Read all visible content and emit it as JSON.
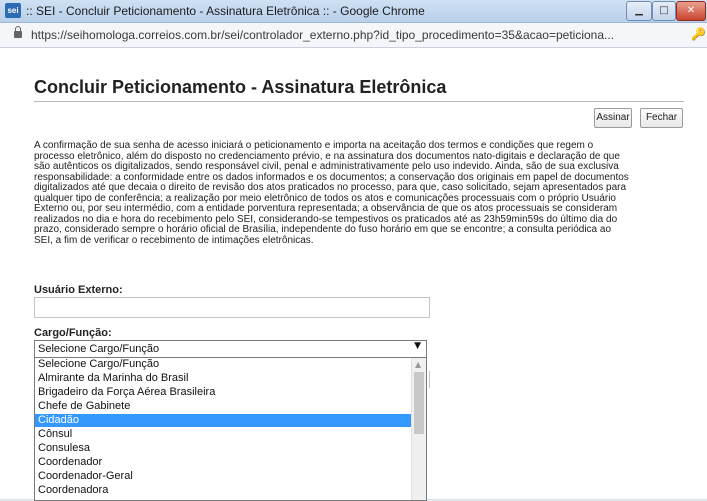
{
  "window": {
    "title": ":: SEI - Concluir Peticionamento - Assinatura Eletrônica :: - Google Chrome",
    "app_icon_text": "sei",
    "url": "https://seihomologa.correios.com.br/sei/controlador_externo.php?id_tipo_procedimento=35&acao=peticiona...",
    "buttons": {
      "minimize": "▁",
      "maximize": "□",
      "close": "✕"
    }
  },
  "page": {
    "title": "Concluir Peticionamento - Assinatura Eletrônica",
    "buttons": {
      "assinar": "Assinar",
      "fechar": "Fechar"
    },
    "paragraph_lines": [
      "A confirmação de sua senha de acesso iniciará o peticionamento e importa na aceitação dos termos e condições que regem o",
      "processo eletrônico, além do disposto no credenciamento prévio, e na assinatura dos documentos nato-digitais e declaração de que",
      "são autênticos os digitalizados, sendo responsável civil, penal e administrativamente pelo uso indevido. Ainda, são de sua exclusiva",
      "responsabilidade: a conformidade entre os dados informados e os documentos; a conservação dos originais em papel de documentos",
      "digitalizados até que decaia o direito de revisão dos atos praticados no processo, para que, caso solicitado, sejam apresentados para",
      "qualquer tipo de conferência; a realização por meio eletrônico de todos os atos e comunicações processuais com o próprio Usuário",
      "Externo ou, por seu intermédio, com a entidade porventura representada; a observância de que os atos processuais se consideram",
      "realizados no dia e hora do recebimento pelo SEI, considerando-se tempestivos os praticados até as 23h59min59s do último dia do",
      "prazo, considerado sempre o horário oficial de Brasília, independente do fuso horário em que se encontre; a consulta periódica ao",
      "SEI, a fim de verificar o recebimento de intimações eletrônicas."
    ],
    "usuario_label": "Usuário Externo:",
    "usuario_value": "",
    "cargo_label": "Cargo/Função:",
    "cargo_selected": "Selecione Cargo/Função",
    "cargo_options": [
      "Selecione Cargo/Função",
      "Almirante da Marinha do Brasil",
      "Brigadeiro da Força Aérea Brasileira",
      "Chefe de Gabinete",
      "Cidadão",
      "Cônsul",
      "Consulesa",
      "Coordenador",
      "Coordenador-Geral",
      "Coordenadora"
    ],
    "highlighted_option_index": 4
  }
}
